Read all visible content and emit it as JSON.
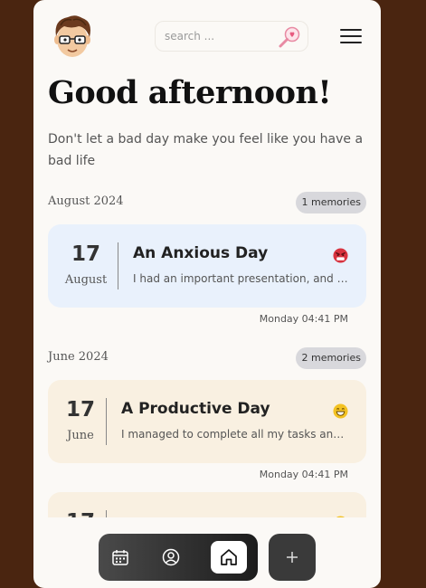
{
  "header": {
    "search_placeholder": "search ...",
    "greeting": "Good afternoon!",
    "subtitle": "Don't let a bad day make you feel like you have a bad life"
  },
  "groups": [
    {
      "month": "August 2024",
      "count_label": "1 memories",
      "entries": [
        {
          "day": "17",
          "month": "August",
          "title": "An Anxious Day",
          "excerpt": "I had an important presentation, and I...",
          "mood": "angry-face-icon",
          "mood_color": "#d8333f",
          "timestamp": "Monday 04:41 PM",
          "bg": "#e9f1fc"
        }
      ]
    },
    {
      "month": "June 2024",
      "count_label": "2 memories",
      "entries": [
        {
          "day": "17",
          "month": "June",
          "title": "A Productive Day",
          "excerpt": "I managed to complete all my tasks and...",
          "mood": "grinning-face-icon",
          "mood_color": "#f3c223",
          "timestamp": "Monday 04:41 PM",
          "bg": "#f9f0e1"
        },
        {
          "day": "17",
          "mood_color": "#f3c223",
          "bg": "#f9f0e1"
        }
      ]
    }
  ],
  "nav": {
    "items": [
      "calendar-icon",
      "profile-icon",
      "home-icon"
    ],
    "active": "home-icon",
    "add": "plus-icon"
  }
}
